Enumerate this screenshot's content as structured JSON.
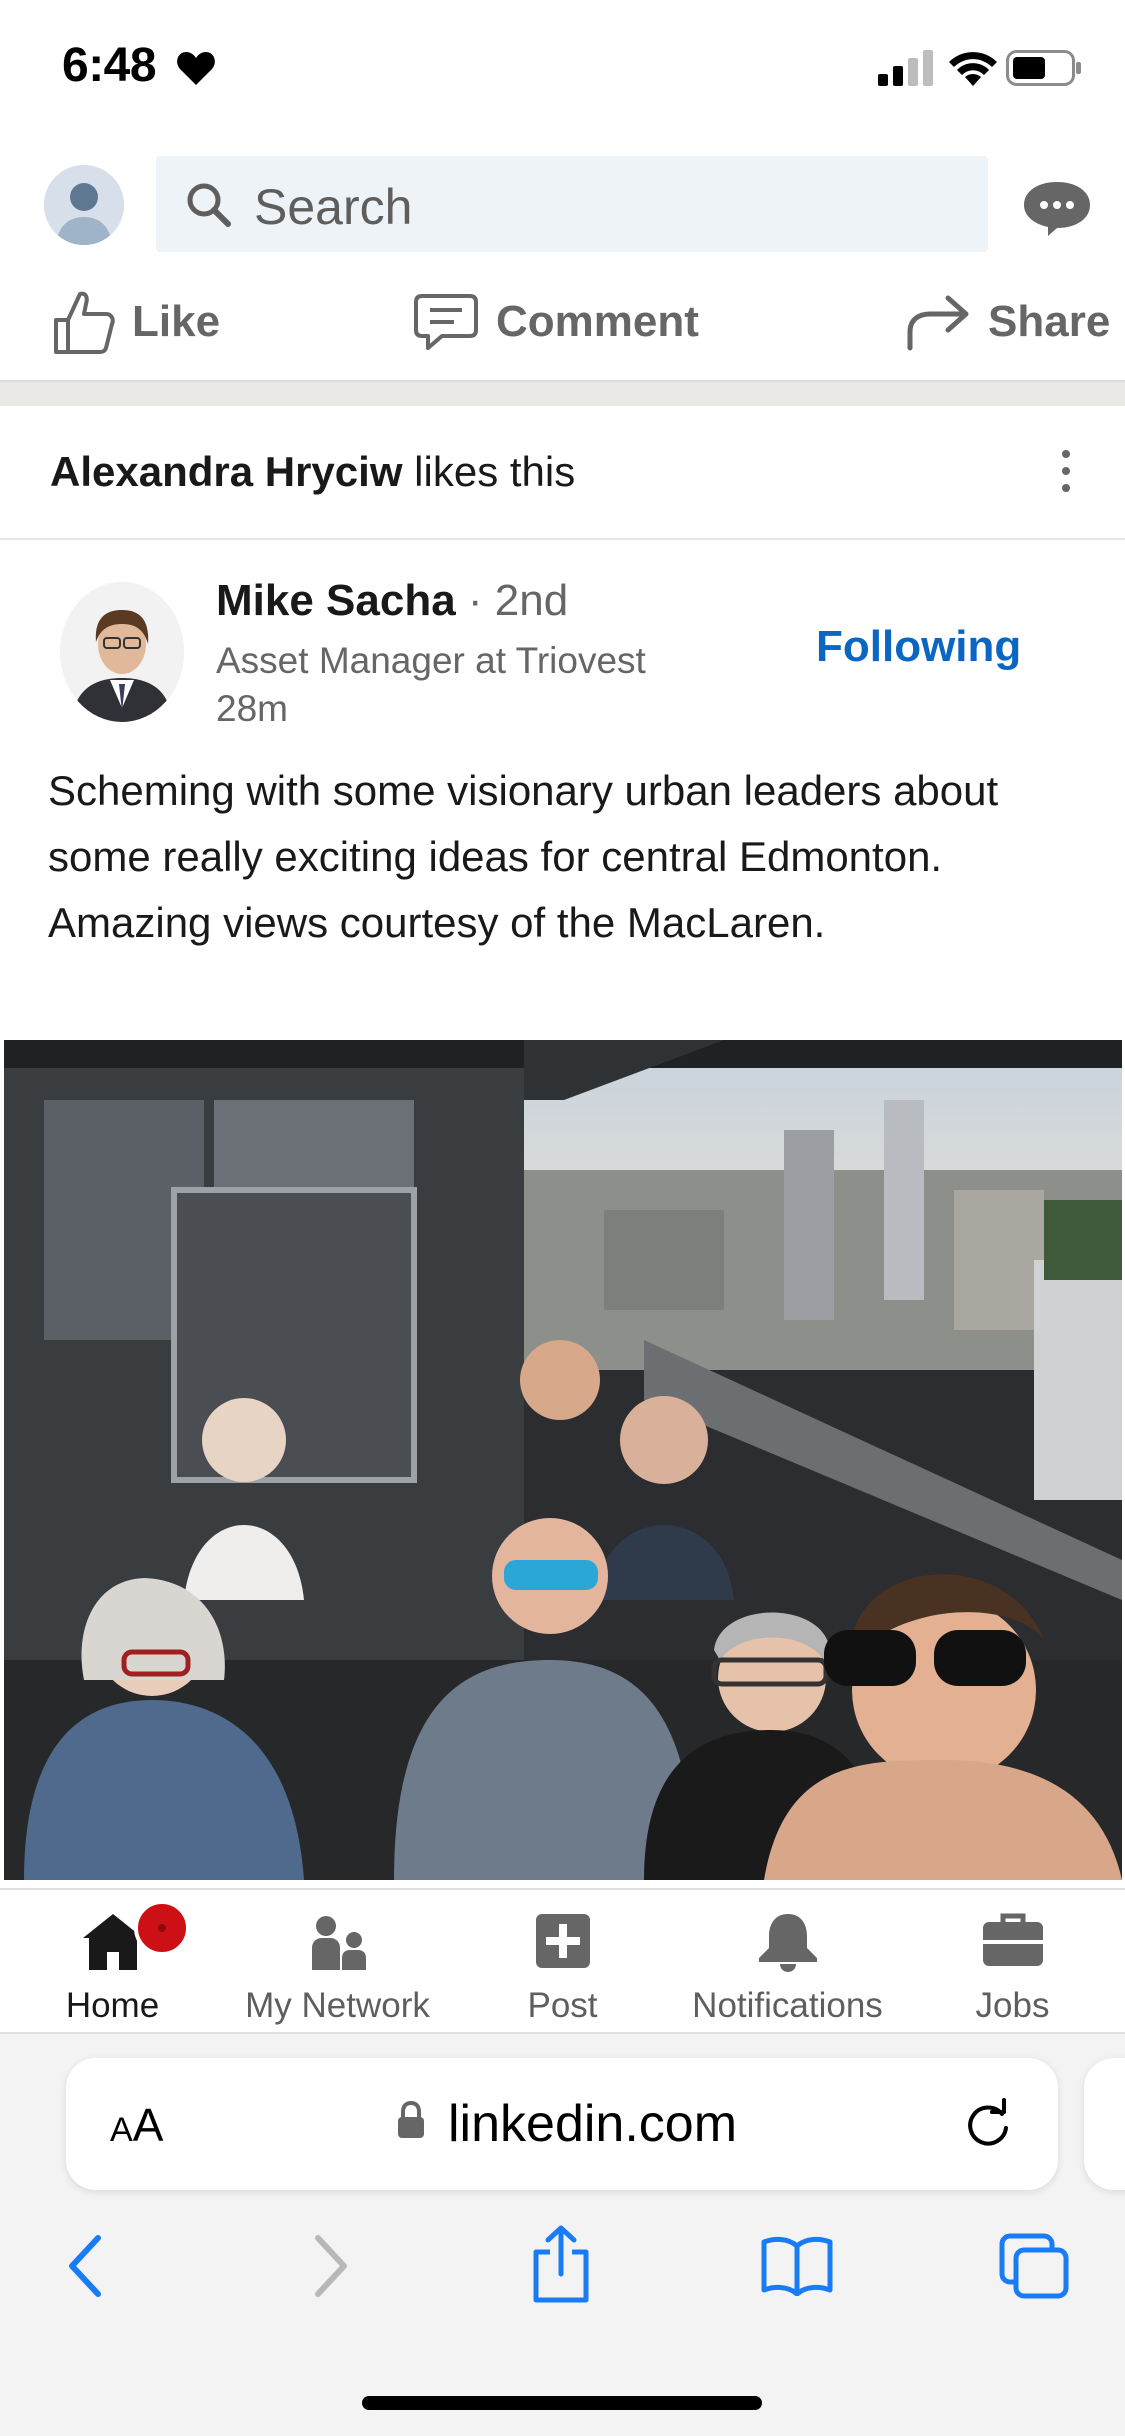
{
  "status_bar": {
    "time": "6:48",
    "heart_icon": "heart-icon",
    "signal_icon": "cellular-signal-icon",
    "wifi_icon": "wifi-icon",
    "battery_icon": "battery-icon"
  },
  "header": {
    "search_placeholder": "Search",
    "avatar_icon": "profile-avatar",
    "messaging_icon": "messaging-icon"
  },
  "actions": {
    "like": "Like",
    "comment": "Comment",
    "share": "Share"
  },
  "social_context": {
    "actor": "Alexandra Hryciw",
    "action": " likes this"
  },
  "post": {
    "author_name": "Mike Sacha",
    "degree": " · 2nd",
    "headline": "Asset Manager at Triovest",
    "time": "28m",
    "follow_status": "Following",
    "text": "Scheming with some visionary urban leaders about some really exciting ideas for central Edmonton. Amazing views courtesy of the MacLaren."
  },
  "bottom_nav": {
    "items": [
      {
        "label": "Home",
        "icon": "home-icon",
        "active": true
      },
      {
        "label": "My Network",
        "icon": "network-icon"
      },
      {
        "label": "Post",
        "icon": "post-icon"
      },
      {
        "label": "Notifications",
        "icon": "bell-icon"
      },
      {
        "label": "Jobs",
        "icon": "briefcase-icon"
      }
    ]
  },
  "browser": {
    "text_size_label_big": "A",
    "text_size_label_small": "A",
    "url": "linkedin.com",
    "toolbar_icons": [
      "back-icon",
      "forward-icon",
      "share-icon",
      "bookmarks-icon",
      "tabs-icon"
    ]
  },
  "colors": {
    "accent_blue": "#0a66c2",
    "notification_red": "#cc1016",
    "ios_blue": "#1a7cf5"
  }
}
